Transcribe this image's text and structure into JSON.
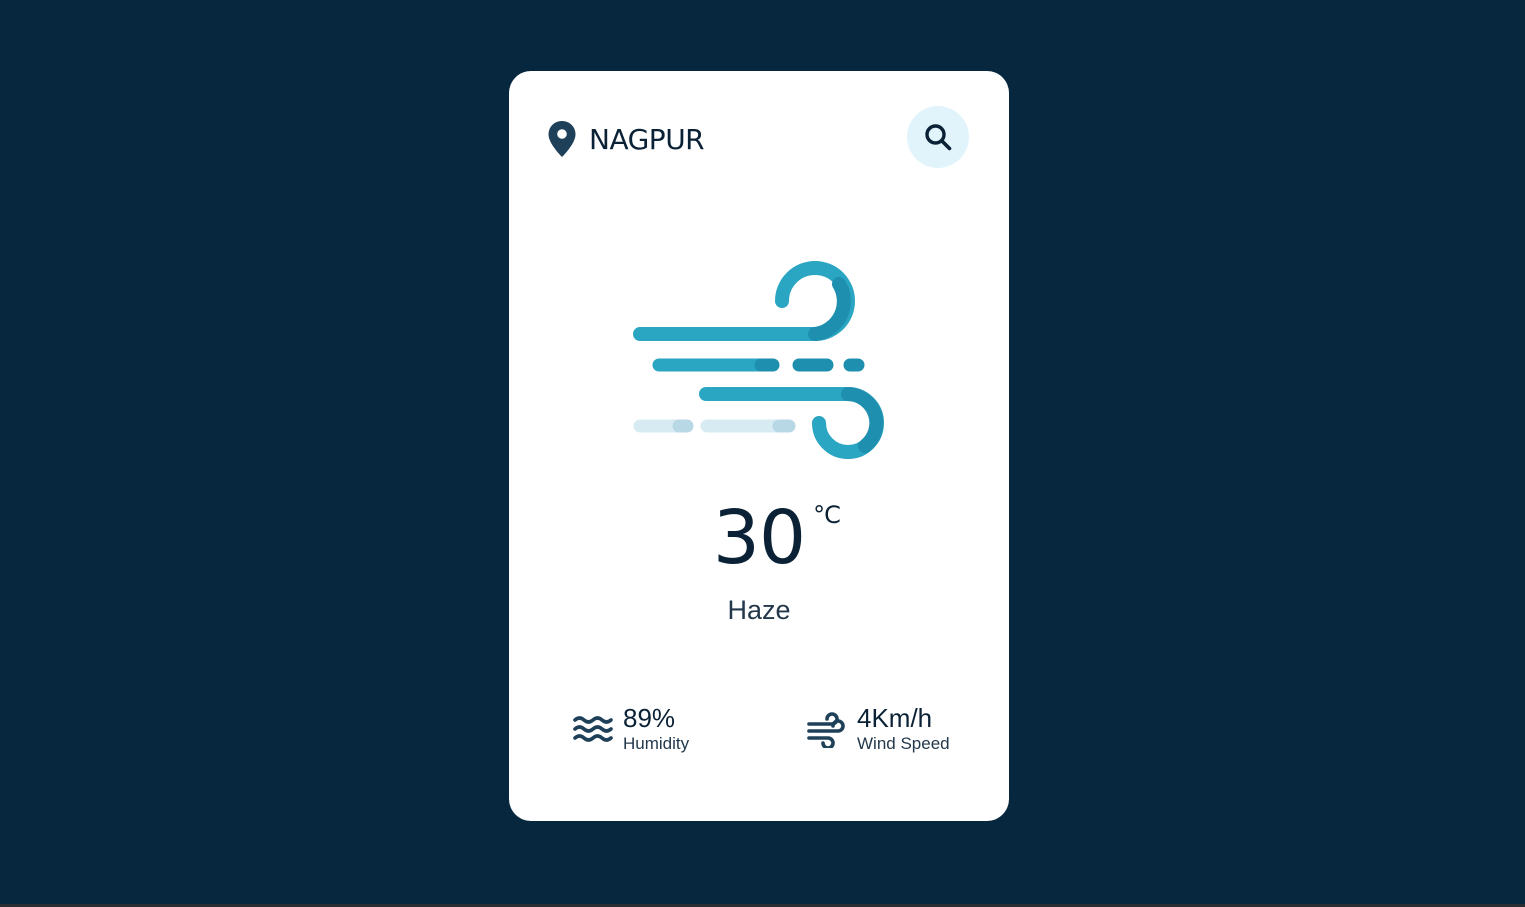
{
  "location": {
    "city": "NAGPUR",
    "icon": "location-pin-icon"
  },
  "search": {
    "icon": "search-icon"
  },
  "weather": {
    "icon": "wind-haze-icon",
    "temperature": "30",
    "unit": "°C",
    "condition": "Haze"
  },
  "stats": {
    "humidity": {
      "icon": "humidity-waves-icon",
      "value": "89%",
      "label": "Humidity"
    },
    "wind": {
      "icon": "wind-speed-icon",
      "value": "4Km/h",
      "label": "Wind Speed"
    }
  },
  "colors": {
    "background": "#06273d",
    "card": "#ffffff",
    "text_primary": "#0b2236",
    "accent": "#26a4c2",
    "search_bg": "#e1f4fc"
  }
}
